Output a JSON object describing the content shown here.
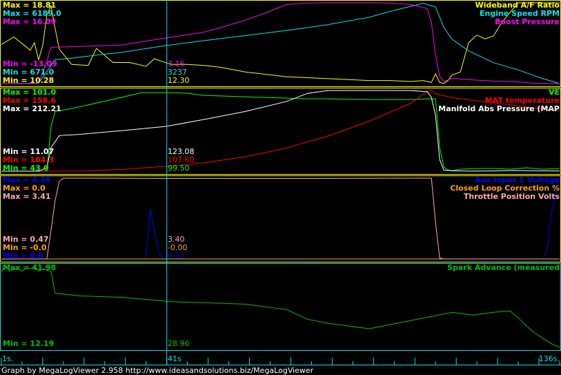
{
  "colors": {
    "afr": "#ffff00",
    "rpm": "#00e5ee",
    "boost": "#ff00ff",
    "ve": "#00ff00",
    "mat": "#ff0000",
    "map": "#ffffff",
    "aux": "#0000ff",
    "clc": "#ffa500",
    "tps": "#ffaaaa",
    "spark": "#00c000",
    "cursor": "#00e5ee",
    "axis": "#00e5ee",
    "divider1": "#ffff00",
    "divider2": "#ffff00",
    "divider3": "#00e5ee"
  },
  "panel1": {
    "max_afr": "Max = 18.81",
    "max_rpm": "Max = 6189.0",
    "max_boost": "Max = 16.09",
    "min_boost": "Min = -13.09",
    "min_rpm": "Min = 671.0",
    "min_afr": "Min = 10.28",
    "cur_boost": "3.16",
    "cur_rpm": "3237",
    "cur_afr": "12.30",
    "name_afr": "Wideband A/F Ratio",
    "name_rpm": "Engine Speed RPM",
    "name_boost": "Boost Pressure"
  },
  "panel2": {
    "max_ve": "Max = 101.0",
    "max_mat": "Max = 158.6",
    "max_map": "Max = 212.21",
    "min_map": "Min = 11.07",
    "min_mat": "Min = 104.3",
    "min_ve": "Min = 43.0",
    "cur_map": "123.08",
    "cur_mat": "107.60",
    "cur_ve": "99.50",
    "name_ve": "VE",
    "name_mat": "MAT temperature",
    "name_map": "Manifold Abs Pressure (MAP"
  },
  "panel3": {
    "max_aux": "Max = 4.39",
    "max_clc": "Max = 0.0",
    "max_tps": "Max = 3.41",
    "min_tps": "Min = 0.47",
    "min_clc": "Min = -0.0",
    "min_aux": "Min = 0.0",
    "cur_tps": "3.40",
    "cur_clc": "-0.00",
    "cur_aux": "0.01",
    "name_aux": "Aux Input 1 Voltage",
    "name_clc": "Closed Loop Correction %",
    "name_tps": "Throttle Position Volts"
  },
  "panel4": {
    "max_spark": "Max = 41.98",
    "min_spark": "Min = 12.19",
    "cur_spark": "28.96",
    "name_spark": "Spark Advance (measured"
  },
  "axis": {
    "start": "1s.",
    "cursor": "41s",
    "end": "136s."
  },
  "footer": "Graph by MegaLogViewer 2.958 http://www.ideasandsolutions.biz/MegaLogViewer",
  "chart_data": {
    "type": "line",
    "x_unit": "s",
    "x_range": [
      1,
      136
    ],
    "cursor_x": 41,
    "panels": [
      {
        "series": [
          {
            "name": "Wideband A/F Ratio",
            "range": [
              10.28,
              18.81
            ],
            "x": [
              1,
              4,
              8,
              9,
              10,
              11,
              12,
              13,
              14,
              15,
              18,
              22,
              24,
              28,
              32,
              36,
              38,
              40,
              42,
              46,
              50,
              54,
              60,
              70,
              80,
              90,
              95,
              100,
              103,
              105,
              106,
              107,
              108,
              109,
              110,
              112,
              114,
              116,
              118,
              120,
              122,
              124,
              126,
              136
            ],
            "y": [
              14.4,
              15.2,
              13.8,
              14.6,
              12.8,
              14.3,
              17.5,
              18.5,
              16.1,
              13.9,
              12.3,
              12.2,
              14.0,
              12.5,
              12.5,
              12.1,
              12.9,
              12.6,
              12.3,
              12.3,
              12.2,
              12.0,
              11.5,
              11.0,
              10.8,
              10.6,
              10.6,
              10.5,
              10.6,
              10.4,
              11.3,
              10.4,
              10.3,
              10.6,
              11.2,
              11.5,
              14.6,
              15.4,
              15.0,
              15.3,
              16.7,
              17.8,
              18.8,
              18.8
            ]
          },
          {
            "name": "Engine Speed RPM",
            "range": [
              671.0,
              6189.0
            ],
            "x": [
              1,
              10,
              14,
              18,
              25,
              30,
              40,
              50,
              60,
              70,
              80,
              90,
              95,
              100,
              103,
              106,
              108,
              110,
              114,
              120,
              126,
              132,
              136
            ],
            "y": [
              671,
              690,
              2300,
              2400,
              2650,
              2800,
              3237,
              3600,
              3950,
              4300,
              4700,
              5200,
              5600,
              5950,
              6150,
              5900,
              4500,
              3700,
              2900,
              2100,
              1600,
              1000,
              671
            ]
          },
          {
            "name": "Boost Pressure",
            "range": [
              -13.09,
              16.09
            ],
            "x": [
              1,
              10,
              12,
              13,
              20,
              30,
              40,
              50,
              55,
              60,
              65,
              70,
              75,
              80,
              90,
              95,
              100,
              104,
              105,
              106,
              107,
              108,
              109,
              110,
              114,
              120,
              126,
              130,
              136
            ],
            "y": [
              -13.09,
              -13.0,
              -5.0,
              0.0,
              0.3,
              0.8,
              3.16,
              5.5,
              7.5,
              9.8,
              12.5,
              15.5,
              16.0,
              16.09,
              16.09,
              16.0,
              15.5,
              14.0,
              9.0,
              -3.0,
              -10.5,
              -12.3,
              -11.8,
              -11.2,
              -11.7,
              -12.2,
              -12.5,
              -13.0,
              -13.09
            ]
          }
        ]
      },
      {
        "series": [
          {
            "name": "VE",
            "range": [
              43.0,
              101.0
            ],
            "x": [
              1,
              12,
              13,
              14,
              18,
              24,
              30,
              35,
              40,
              41,
              46,
              50,
              60,
              65,
              70,
              75,
              80,
              90,
              100,
              104,
              106,
              107,
              108,
              109,
              110,
              112,
              116,
              120,
              124,
              128,
              132,
              136
            ],
            "y": [
              43.0,
              43.0,
              75.0,
              86.0,
              88.0,
              92.0,
              96.0,
              99.5,
              99.5,
              99.5,
              99.0,
              97.5,
              96.5,
              96.0,
              95.5,
              95.0,
              95.0,
              94.5,
              94.5,
              95.0,
              95.0,
              60.0,
              46.0,
              44.0,
              43.5,
              44.5,
              45.0,
              45.0,
              44.5,
              45.5,
              44.5,
              45.0
            ]
          },
          {
            "name": "MAT temperature",
            "range": [
              104.3,
              158.6
            ],
            "x": [
              1,
              20,
              30,
              40,
              41,
              50,
              60,
              70,
              80,
              90,
              100,
              104,
              105,
              106,
              108,
              112,
              118,
              124,
              128,
              132,
              136
            ],
            "y": [
              104.3,
              104.5,
              105.5,
              107.5,
              107.6,
              110.0,
              114.0,
              120.0,
              128.0,
              138.0,
              150.0,
              158.0,
              158.6,
              156.5,
              155.0,
              153.0,
              151.0,
              149.0,
              147.5,
              146.0,
              145.0
            ]
          },
          {
            "name": "Manifold Abs Pressure (MAP)",
            "range": [
              11.07,
              212.21
            ],
            "x": [
              1,
              10,
              12,
              13,
              15,
              20,
              30,
              40,
              41,
              50,
              60,
              70,
              75,
              80,
              90,
              100,
              104,
              105,
              106,
              107,
              108,
              110,
              114,
              120,
              125,
              130,
              136
            ],
            "y": [
              11.07,
              11.5,
              20.0,
              70.0,
              100.0,
              103.0,
              112.0,
              122.0,
              123.08,
              140.0,
              160.0,
              185.0,
              205.0,
              212.0,
              212.21,
              212.0,
              209.0,
              195.0,
              150.0,
              40.0,
              14.0,
              12.5,
              11.5,
              12.0,
              13.0,
              12.5,
              12.0
            ]
          }
        ]
      },
      {
        "series": [
          {
            "name": "Aux Input 1 Voltage",
            "range": [
              0.0,
              4.39
            ],
            "x": [
              1,
              36,
              37,
              38,
              39,
              40,
              41,
              130,
              132,
              133,
              134,
              136
            ],
            "y": [
              0.0,
              0.0,
              2.7,
              1.6,
              0.4,
              0.05,
              0.01,
              0.0,
              0.0,
              0.5,
              2.5,
              4.39
            ]
          },
          {
            "name": "Closed Loop Correction %",
            "range": [
              -0.0,
              0.0
            ],
            "x": [
              1,
              136
            ],
            "y": [
              0.0,
              0.0
            ]
          },
          {
            "name": "Throttle Position Volts",
            "range": [
              0.47,
              3.41
            ],
            "x": [
              1,
              12,
              13,
              14,
              15,
              16,
              20,
              40,
              41,
              60,
              80,
              100,
              105,
              106,
              107,
              108,
              109,
              110,
              114,
              120,
              130,
              136
            ],
            "y": [
              0.47,
              0.47,
              1.5,
              2.6,
              3.3,
              3.41,
              3.41,
              3.4,
              3.4,
              3.4,
              3.4,
              3.41,
              3.41,
              1.8,
              0.5,
              0.47,
              0.47,
              0.47,
              0.47,
              0.47,
              0.47,
              0.47
            ]
          }
        ]
      },
      {
        "series": [
          {
            "name": "Spark Advance (measured)",
            "range": [
              12.19,
              41.98
            ],
            "x": [
              1,
              2,
              3,
              4,
              5,
              6,
              7,
              8,
              9,
              10,
              11,
              13,
              14,
              20,
              30,
              40,
              41,
              50,
              60,
              70,
              75,
              80,
              85,
              90,
              100,
              110,
              115,
              120,
              124,
              126,
              128,
              130,
              134,
              136
            ],
            "y": [
              40.0,
              41.98,
              40.0,
              41.0,
              40.8,
              40.0,
              41.2,
              41.0,
              41.5,
              40.0,
              40.8,
              40.0,
              32.0,
              31.0,
              30.5,
              29.2,
              28.96,
              28.5,
              28.0,
              26.0,
              22.5,
              21.0,
              20.0,
              19.0,
              22.0,
              25.0,
              24.0,
              25.0,
              25.5,
              23.0,
              20.0,
              17.5,
              13.5,
              12.19
            ]
          }
        ]
      }
    ]
  }
}
